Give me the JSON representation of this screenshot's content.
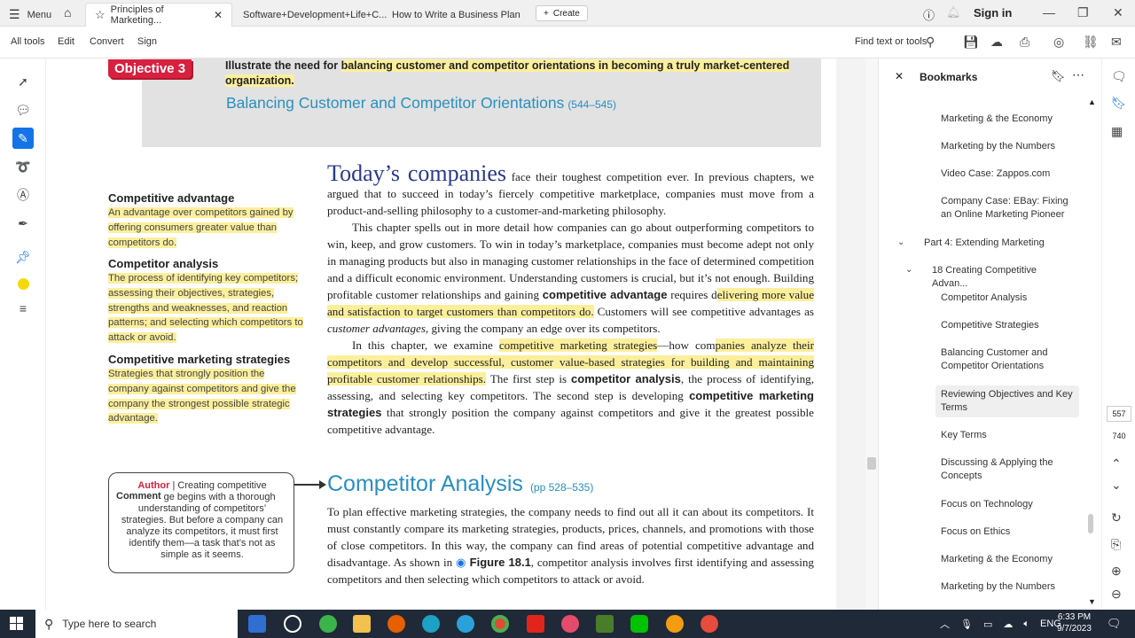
{
  "tabbar": {
    "menu_label": "Menu",
    "tabs": [
      {
        "label": "Principles of Marketing..."
      },
      {
        "label": "Software+Development+Life+C..."
      },
      {
        "label": "How to Write a Business Plan"
      }
    ],
    "create_label": "Create",
    "signin_label": "Sign in"
  },
  "toolbar": {
    "items": [
      "All tools",
      "Edit",
      "Convert",
      "Sign"
    ],
    "find_label": "Find text or tools"
  },
  "document": {
    "objective_tag": "Objective 3",
    "objective_text_pre": "Illustrate the need for ",
    "objective_text_hl": "balancing customer and competitor orientations in becoming a truly market-centered organization.",
    "objective_section_title": "Balancing Customer and Competitor Orientations",
    "objective_section_pages": "(544–545)",
    "today_big": "Today’s companies",
    "p1_rest": " face their toughest competition ever. In previous chapters, we argued that to succeed in today’s fiercely competitive marketplace, companies must move from a product-and-selling philosophy to a customer-and-marketing philosophy.",
    "p2_a": "This chapter spells out in more detail how companies can go about outperforming competitors to win, keep, and grow customers. To win in today’s marketplace, companies must become adept not only in managing products but also in managing customer relationships in the face of determined competition and a difficult economic environment. Understanding customers is crucial, but it’s not enough. Building profitable customer relationships and gaining ",
    "p2_term": "competitive advantage",
    "p2_b": " requires d",
    "p2_hl": "elivering more value and satisfaction to target customers than competitors do.",
    "p2_c": " Customers will see competitive advantages as ",
    "p2_italic": "customer advantages",
    "p2_d": ", giving the company an edge over its competitors.",
    "p3_a": "In this chapter, we examine ",
    "p3_hl1": "competitive marketing strategies",
    "p3_b": "—how com",
    "p3_hl2": "panies analyze their competitors and develop successful, customer value-based strategies for building and maintaining profitable customer relationships.",
    "p3_c": " The first step is ",
    "p3_term1": "competitor analysis",
    "p3_d": ", the process of identifying, assessing, and selecting key competitors. The second step is developing ",
    "p3_term2": "competitive marketing strategies",
    "p3_e": " that strongly position the company against competitors and give it the greatest possible competitive advantage.",
    "margin_terms": [
      {
        "term": "Competitive advantage",
        "def": "An advantage over competitors gained by offering consumers greater value than competitors do."
      },
      {
        "term": "Competitor analysis",
        "def": "The process of identifying key competitors; assessing their objectives, strategies, strengths and weaknesses, and reaction patterns; and selecting which competitors to attack or avoid."
      },
      {
        "term": "Competitive marketing strategies",
        "def": "Strategies that strongly position the company against competitors and give the company the strongest possible strategic advantage."
      }
    ],
    "author_label_1": "Author",
    "author_label_2": "Comment",
    "author_text": "Creating competitive advantage begins with a thorough understanding of competitors’ strategies. But before a company can analyze its competitors, it must first identify them—a task that’s not as simple as it seems.",
    "section2_title": "Competitor Analysis",
    "section2_pages": "(pp 528–535)",
    "p4_a": "To plan effective marketing strategies, the company needs to find out all it can about its competitors. It must constantly compare its marketing strategies, products, prices, channels, and promotions with those of close competitors. In this way, the company can find areas of potential competitive advantage and disadvantage. As shown in ",
    "p4_fig": "Figure 18.1",
    "p4_b": ", competitor analysis involves first identifying and assessing competitors and then selecting which competitors to attack or avoid."
  },
  "bookmarks": {
    "title": "Bookmarks",
    "items": [
      {
        "label": "Marketing & the Economy"
      },
      {
        "label": "Marketing by the Numbers"
      },
      {
        "label": "Video Case: Zappos.com"
      },
      {
        "label": "Company Case: EBay: Fixing an Online Marketing Pioneer"
      },
      {
        "label": "Part 4: Extending Marketing"
      },
      {
        "label": "18 Creating Competitive Advan..."
      },
      {
        "label": "Competitor Analysis"
      },
      {
        "label": "Competitive Strategies"
      },
      {
        "label": "Balancing Customer and Competitor Orientations"
      },
      {
        "label": "Reviewing Objectives and Key Terms"
      },
      {
        "label": "Key Terms"
      },
      {
        "label": "Discussing & Applying the Concepts"
      },
      {
        "label": "Focus on Technology"
      },
      {
        "label": "Focus on Ethics"
      },
      {
        "label": "Marketing & the Economy"
      },
      {
        "label": "Marketing by the Numbers"
      }
    ]
  },
  "rightrail": {
    "page_current": "557",
    "page_total": "740"
  },
  "taskbar": {
    "search_placeholder": "Type here to search",
    "lang": "ENG",
    "time": "6:33 PM",
    "date": "9/7/2023"
  },
  "colors": {
    "highlight": "#fcef9c",
    "objective_red": "#d8203f",
    "heading_blue": "#2a8fc0",
    "accent_blue": "#1473e6"
  }
}
